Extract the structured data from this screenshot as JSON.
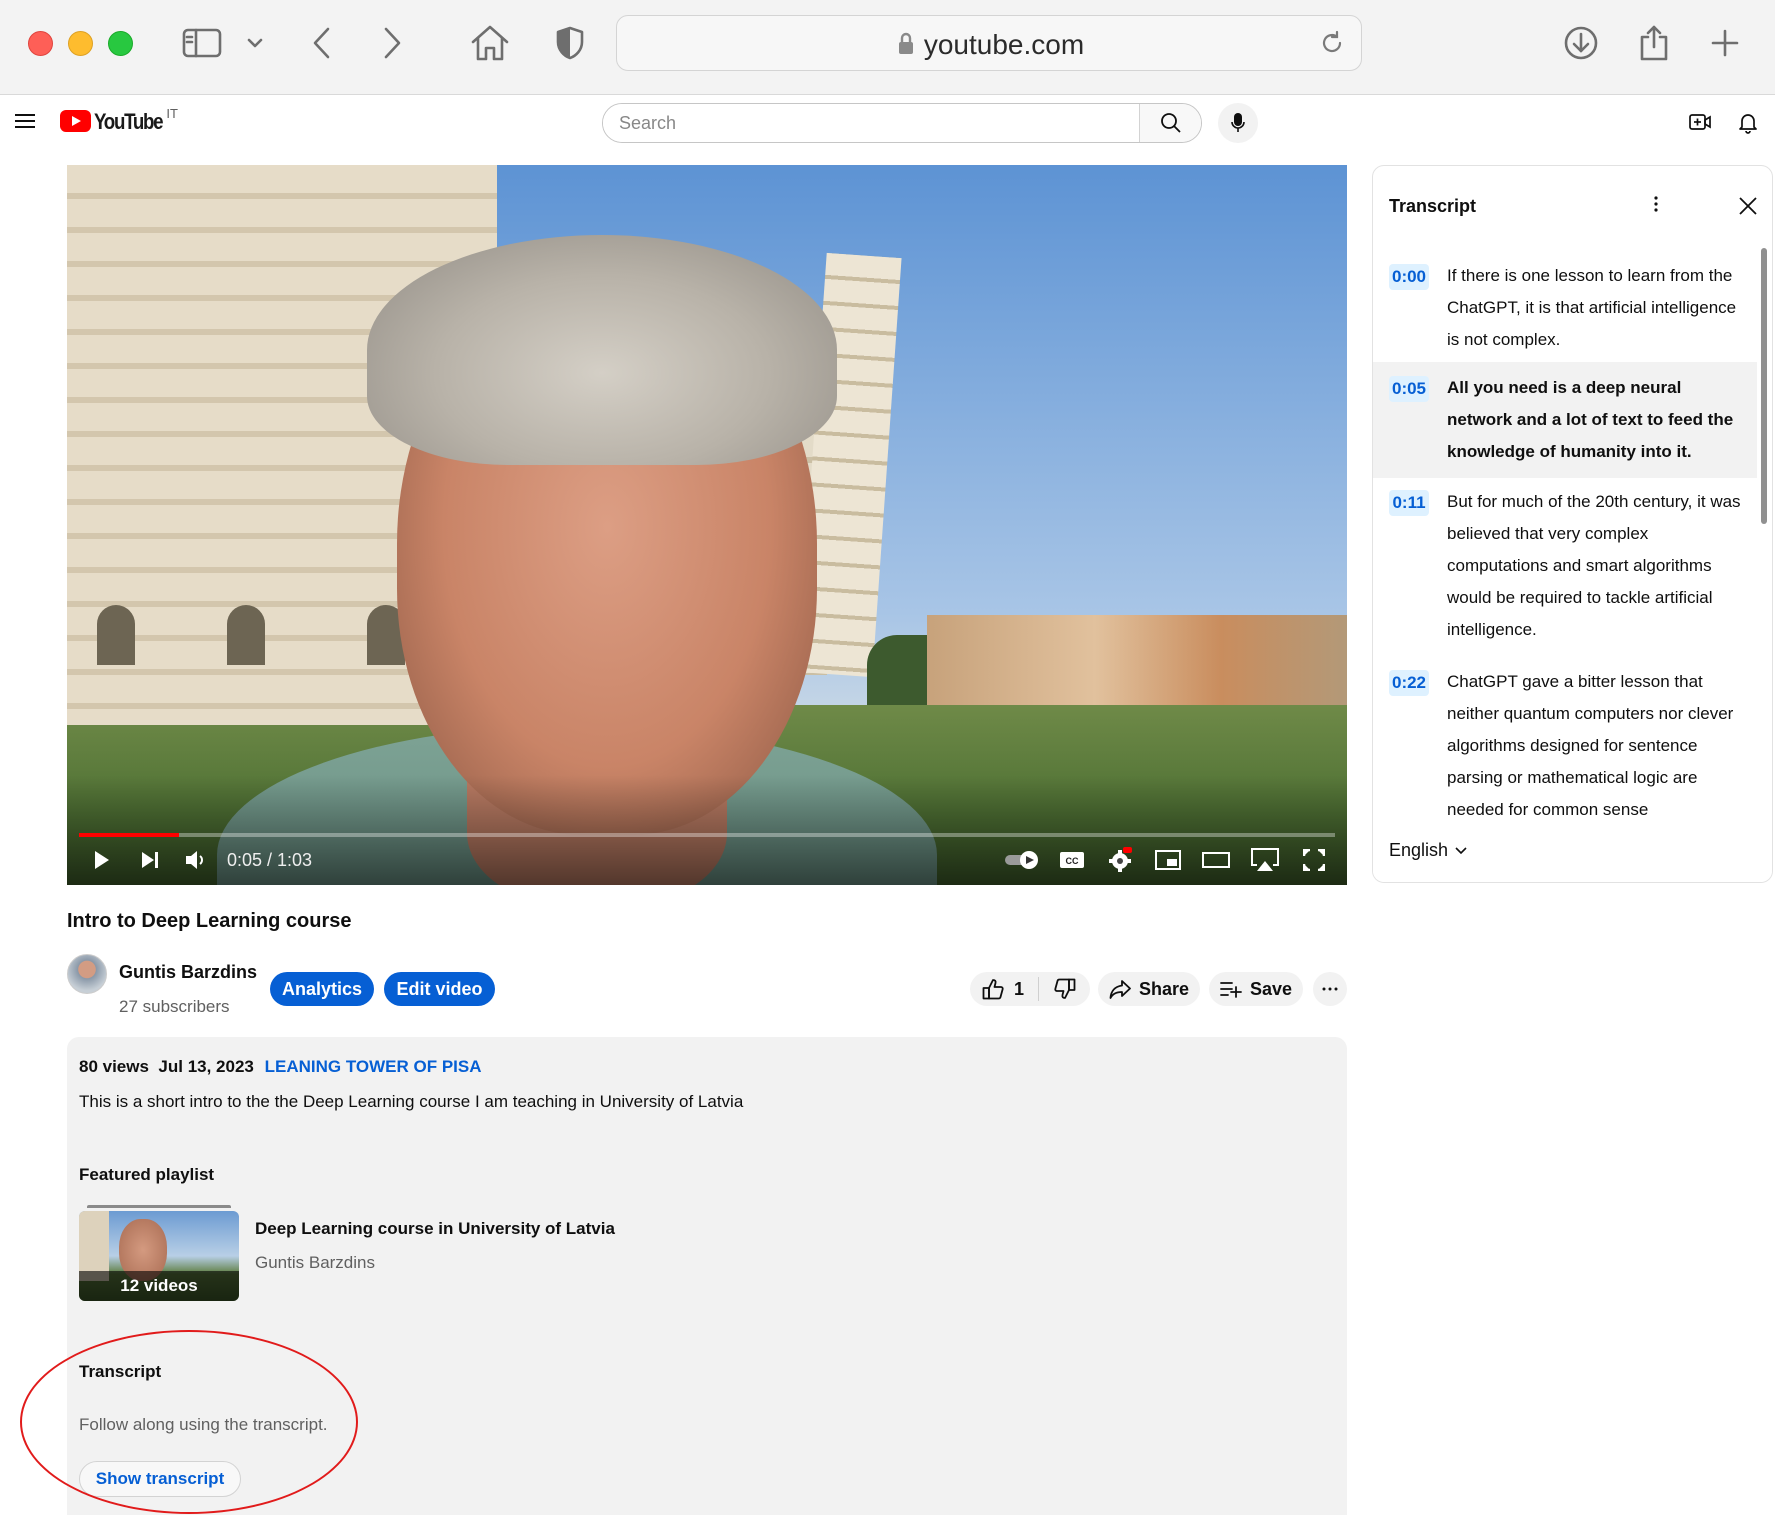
{
  "browser": {
    "url": "youtube.com"
  },
  "header": {
    "logo_text": "YouTube",
    "region": "IT",
    "search_placeholder": "Search"
  },
  "player": {
    "time": "0:05 / 1:03",
    "progress_fraction": 0.08
  },
  "video": {
    "title": "Intro to Deep Learning course",
    "channel": "Guntis Barzdins",
    "subscribers": "27 subscribers",
    "analytics_label": "Analytics",
    "edit_label": "Edit video",
    "like_count": "1",
    "share_label": "Share",
    "save_label": "Save"
  },
  "description": {
    "views": "80 views",
    "date": "Jul 13, 2023",
    "location": "LEANING TOWER OF PISA",
    "text": "This is a short intro to the the Deep Learning course I am teaching in University of Latvia",
    "featured_label": "Featured playlist",
    "playlist_count": "12 videos",
    "playlist_name": "Deep Learning course in University of Latvia",
    "playlist_owner": "Guntis Barzdins",
    "transcript_heading": "Transcript",
    "transcript_sub": "Follow along using the transcript.",
    "show_transcript": "Show transcript"
  },
  "transcript": {
    "title": "Transcript",
    "language": "English",
    "segments": [
      {
        "time": "0:00",
        "text": "If there is one lesson to learn from the ChatGPT, it is that artificial intelligence is not complex."
      },
      {
        "time": "0:05",
        "text": "All you need is a deep neural network and a lot of text to feed the knowledge of humanity into it."
      },
      {
        "time": "0:11",
        "text": "But for much of the 20th century, it was believed that very complex computations and smart algorithms would be required to tackle artificial intelligence."
      },
      {
        "time": "0:22",
        "text": "ChatGPT gave a bitter lesson that neither quantum computers nor clever algorithms designed for sentence parsing or mathematical logic are needed for common sense"
      }
    ]
  },
  "colors": {
    "accent": "#065fd4",
    "brand": "#ff0000",
    "annotation": "#e11b1b"
  }
}
